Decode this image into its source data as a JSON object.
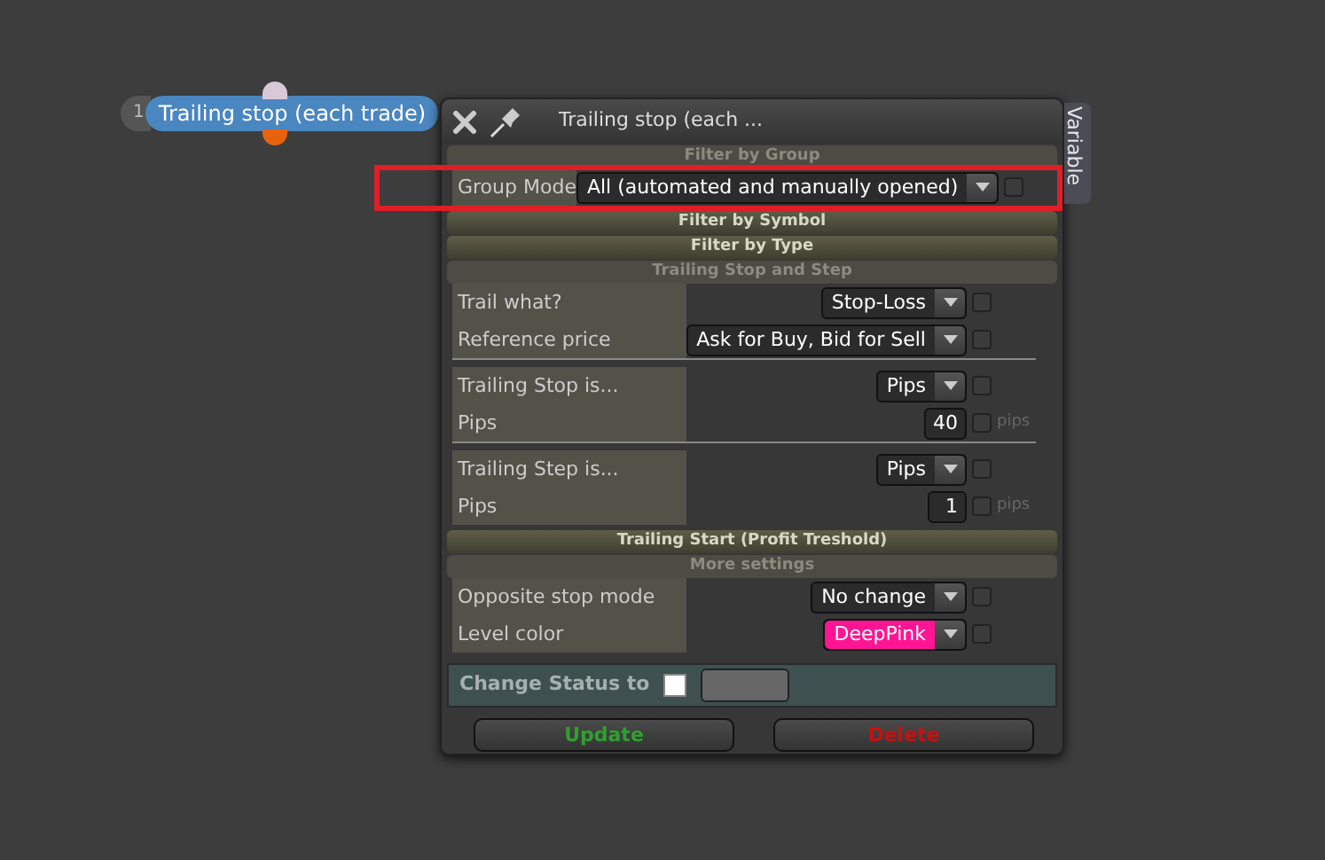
{
  "node": {
    "index": "1",
    "title": "Trailing stop (each trade)"
  },
  "window": {
    "title": "Trailing stop (each ...",
    "side_tab": "Variable"
  },
  "sections": [
    {
      "title": "Filter by Group",
      "expanded": true,
      "groups": [
        [
          {
            "label": "Group Mode",
            "kind": "select",
            "value": "All (automated and manually opened)",
            "checked": false
          }
        ]
      ]
    },
    {
      "title": "Filter by Symbol",
      "expanded": false
    },
    {
      "title": "Filter by Type",
      "expanded": false
    },
    {
      "title": "Trailing Stop and Step",
      "expanded": true,
      "groups": [
        [
          {
            "label": "Trail what?",
            "kind": "select",
            "value": "Stop-Loss",
            "checked": false
          },
          {
            "label": "Reference price",
            "kind": "select",
            "value": "Ask for Buy, Bid for Sell",
            "checked": false
          }
        ],
        [
          {
            "label": "Trailing Stop is...",
            "kind": "select",
            "value": "Pips",
            "checked": false
          },
          {
            "label": "Pips",
            "kind": "number",
            "value": "40",
            "checked": false,
            "unit": "pips"
          }
        ],
        [
          {
            "label": "Trailing Step is...",
            "kind": "select",
            "value": "Pips",
            "checked": false
          },
          {
            "label": "Pips",
            "kind": "number",
            "value": "1",
            "checked": false,
            "unit": "pips"
          }
        ]
      ]
    },
    {
      "title": "Trailing Start (Profit Treshold)",
      "expanded": false
    },
    {
      "title": "More settings",
      "expanded": true,
      "groups": [
        [
          {
            "label": "Opposite stop mode",
            "kind": "select",
            "value": "No change",
            "checked": false
          },
          {
            "label": "Level color",
            "kind": "select",
            "value": "DeepPink",
            "color": "#ff1493",
            "checked": false
          }
        ]
      ]
    }
  ],
  "status": {
    "label": "Change Status to",
    "checked": false
  },
  "buttons": [
    {
      "label": "Update",
      "kind": "update"
    },
    {
      "label": "Delete",
      "kind": "delete"
    }
  ]
}
